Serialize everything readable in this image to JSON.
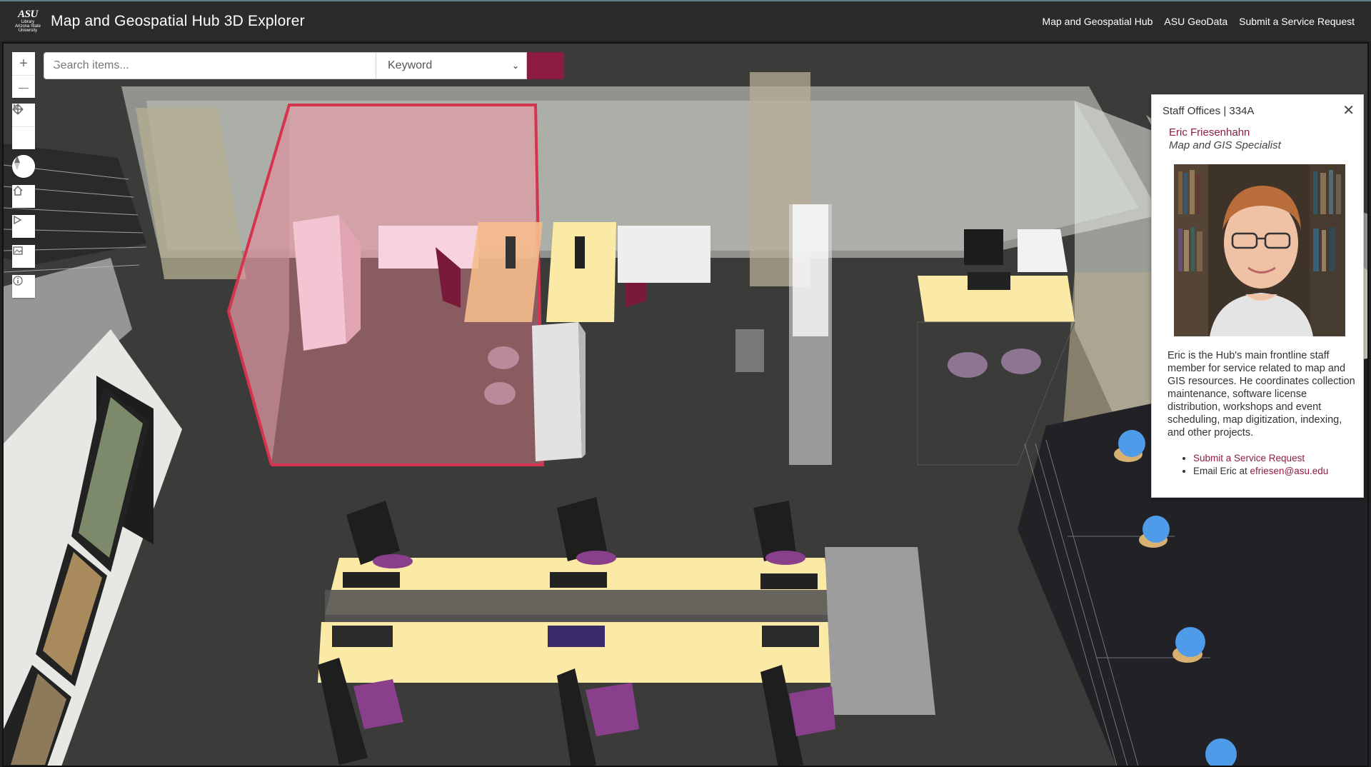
{
  "header": {
    "logo_text": "ASU",
    "logo_sub": "Library Arizona State University",
    "title": "Map and Geospatial Hub 3D Explorer",
    "links": [
      "Map and Geospatial Hub",
      "ASU GeoData",
      "Submit a Service Request"
    ]
  },
  "search": {
    "placeholder": "Search items...",
    "mode_selected": "Keyword"
  },
  "map_controls": {
    "zoom_in": "+",
    "zoom_out": "—",
    "tools": [
      "pan-icon",
      "rotate-icon",
      "compass-icon",
      "home-icon",
      "play-icon",
      "layers-icon",
      "info-icon"
    ]
  },
  "popup": {
    "title": "Staff Offices | 334A",
    "close_label": "✕",
    "name": "Eric Friesenhahn",
    "role": "Map and GIS Specialist",
    "bio": "Eric is the Hub's main frontline staff member for service related to map and GIS resources. He coordinates collection maintenance, software license distribution, workshops and event scheduling, map digitization, indexing, and other projects.",
    "link1": "Submit a Service Request",
    "link2_prefix": "Email Eric at ",
    "link2_email": "efriesen@asu.edu"
  },
  "colors": {
    "accent": "#8c1d40",
    "header_bg": "#2b2b2b",
    "selection": "#d6334f",
    "desk": "#fbe9a6",
    "floor": "#3a3a38"
  }
}
